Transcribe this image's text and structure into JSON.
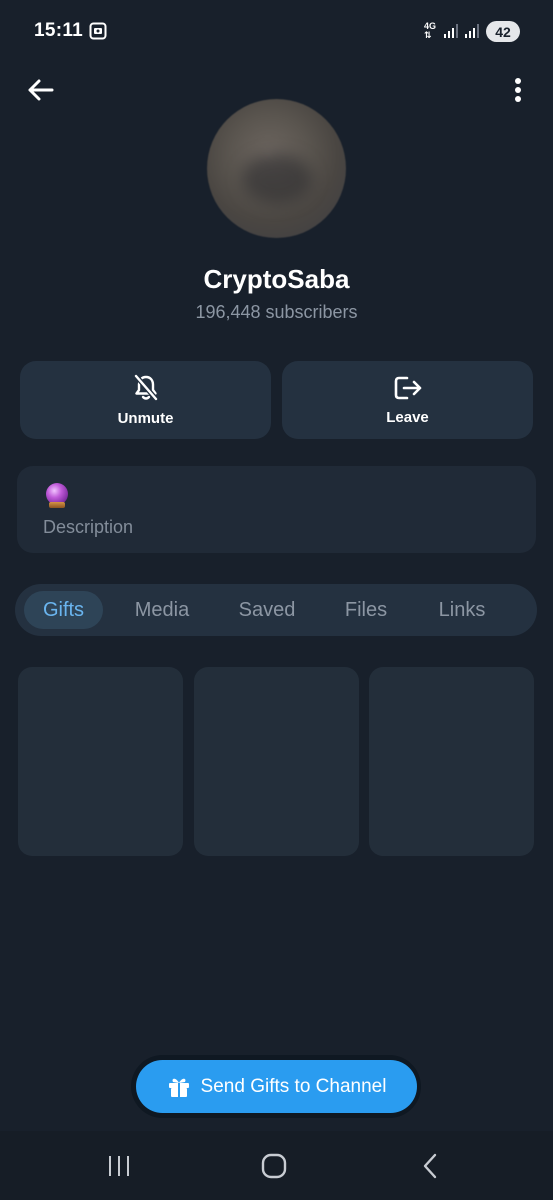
{
  "status_bar": {
    "time": "15:11",
    "network": "4G",
    "battery": "42"
  },
  "channel": {
    "name": "CryptoSaba",
    "subscribers": "196,448 subscribers"
  },
  "actions": {
    "unmute_label": "Unmute",
    "leave_label": "Leave"
  },
  "description": {
    "emoji": "crystal-ball",
    "label": "Description"
  },
  "tabs": [
    {
      "label": "Gifts",
      "active": true
    },
    {
      "label": "Media",
      "active": false
    },
    {
      "label": "Saved",
      "active": false
    },
    {
      "label": "Files",
      "active": false
    },
    {
      "label": "Links",
      "active": false
    }
  ],
  "send_gifts": {
    "label": "Send Gifts to Channel"
  },
  "colors": {
    "background": "#18202b",
    "accent": "#2a9cf0",
    "active_tab_text": "#6ab5ef"
  }
}
